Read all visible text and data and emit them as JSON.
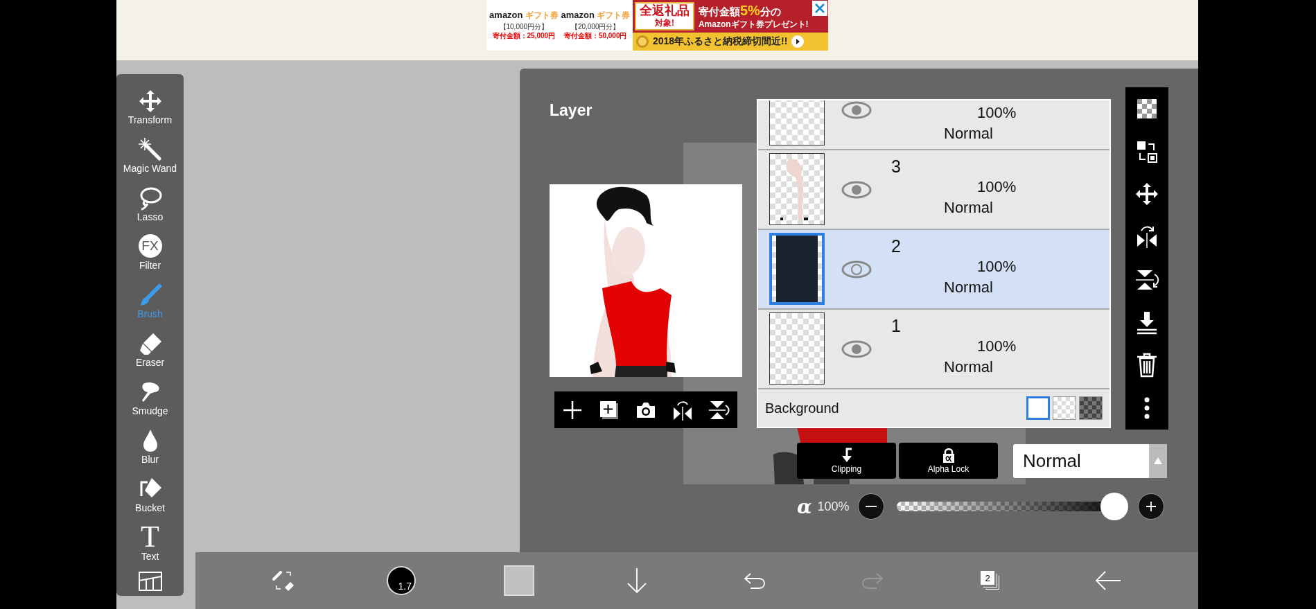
{
  "ad_banner": {
    "products": [
      {
        "brand": "amazon",
        "label": "ギフト券",
        "amount": "【10,000円分】",
        "donation": "寄付金額：25,000円"
      },
      {
        "brand": "amazon",
        "label": "ギフト券",
        "amount": "【20,000円分】",
        "donation": "寄付金額：50,000円"
      }
    ],
    "badge": [
      "全返礼品",
      "対象!"
    ],
    "headline": "寄付金額**5%**分の",
    "subline": "Amazonギフト券プレゼント!",
    "deadline": "2018年ふるさと納税締切間近!!"
  },
  "toolbar": {
    "tools": [
      {
        "label": "Transform",
        "selected": false
      },
      {
        "label": "Magic Wand",
        "selected": false
      },
      {
        "label": "Lasso",
        "selected": false
      },
      {
        "label": "Filter",
        "glyph": "FX",
        "selected": false
      },
      {
        "label": "Brush",
        "selected": true
      },
      {
        "label": "Eraser",
        "selected": false
      },
      {
        "label": "Smudge",
        "selected": false
      },
      {
        "label": "Blur",
        "selected": false
      },
      {
        "label": "Bucket",
        "selected": false
      },
      {
        "label": "Text",
        "glyph": "T",
        "selected": false
      }
    ]
  },
  "layer_panel": {
    "title": "Layer",
    "layers": [
      {
        "opacity": "100%",
        "blend": "Normal",
        "kind": "empty",
        "visible": true,
        "selected": false
      },
      {
        "name": "3",
        "opacity": "100%",
        "blend": "Normal",
        "kind": "sketch",
        "visible": true,
        "selected": false
      },
      {
        "name": "2",
        "opacity": "100%",
        "blend": "Normal",
        "kind": "photo",
        "visible": true,
        "selected": true
      },
      {
        "name": "1",
        "opacity": "100%",
        "blend": "Normal",
        "kind": "empty",
        "visible": true,
        "selected": false
      }
    ],
    "background": {
      "label": "Background",
      "options": [
        {
          "kind": "white",
          "selected": true
        },
        {
          "kind": "checker",
          "selected": false
        },
        {
          "kind": "dark",
          "selected": false
        }
      ]
    },
    "clipping": {
      "label": "Clipping"
    },
    "alpha_lock": {
      "label": "Alpha Lock"
    },
    "blend_mode": {
      "value": "Normal"
    },
    "opacity": {
      "symbol": "α",
      "reading": "100%",
      "level": 1
    }
  },
  "bottom_bar": {
    "brush_size": "1.7",
    "layer_count": "2",
    "history": [
      {
        "kind": "undo",
        "disabled": false
      },
      {
        "kind": "redo",
        "disabled": true
      }
    ]
  }
}
